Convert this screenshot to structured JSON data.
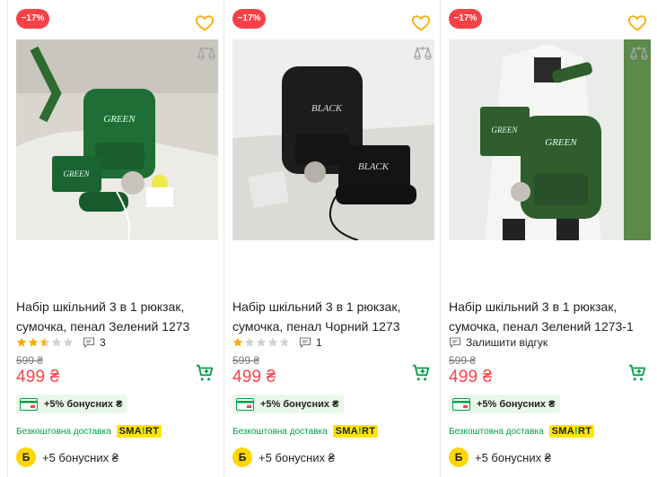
{
  "products": [
    {
      "discount": "−17%",
      "title": "Набір шкільний 3 в 1 рюкзак, сумочка, пенал Зелений 1273",
      "rating": 2.5,
      "reviews_count": "3",
      "old_price": "599 ₴",
      "price": "499 ₴",
      "bonus_pill": "+5% бонусних ₴",
      "delivery": "Безкоштовна доставка",
      "smart_label": "SMA!RT",
      "bonus_letter": "Б",
      "bonus_text": "+5 бонусних ₴",
      "bag_color": "#1f6e35",
      "bag_text": "GREEN"
    },
    {
      "discount": "−17%",
      "title": "Набір шкільний 3 в 1 рюкзак, сумочка, пенал Чорний 1273",
      "rating": 1,
      "reviews_count": "1",
      "old_price": "599 ₴",
      "price": "499 ₴",
      "bonus_pill": "+5% бонусних ₴",
      "delivery": "Безкоштовна доставка",
      "smart_label": "SMA!RT",
      "bonus_letter": "Б",
      "bonus_text": "+5 бонусних ₴",
      "bag_color": "#1c1c1c",
      "bag_text": "BLACK"
    },
    {
      "discount": "−17%",
      "title": "Набір шкільний 3 в 1 рюкзак, сумочка, пенал Зелений 1273-1",
      "review_link": "Залишити відгук",
      "old_price": "599 ₴",
      "price": "499 ₴",
      "bonus_pill": "+5% бонусних ₴",
      "delivery": "Безкоштовна доставка",
      "smart_label": "SMA!RT",
      "bonus_letter": "Б",
      "bonus_text": "+5 бонусних ₴",
      "bag_color": "#2f5d2c",
      "bag_text": "GREEN"
    }
  ],
  "colors": {
    "accent_red": "#f84147",
    "accent_green": "#00a046",
    "star_gold": "#ffa900",
    "heart_gold": "#ffa900",
    "smart_yellow": "#ffe600"
  }
}
